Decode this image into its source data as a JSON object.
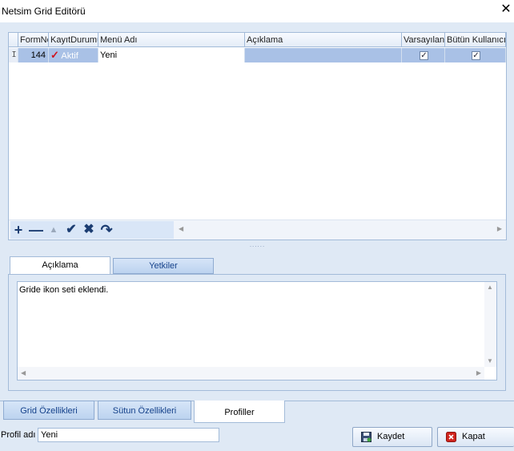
{
  "window": {
    "title": "Netsim Grid Editörü",
    "close_glyph": "✕"
  },
  "grid": {
    "columns": [
      "FormNo",
      "KayıtDurumu",
      "Menü Adı",
      "Açıklama",
      "Varsayılan",
      "Bütün Kullanıcılar"
    ],
    "rows": [
      {
        "indicator": "I",
        "form_no": "144",
        "kayit_durumu": "Aktif",
        "menu_adi": "Yeni",
        "aciklama": "",
        "varsayilan": "✓",
        "butun_kullanicilar": "✓"
      }
    ],
    "nav_icons": [
      "plus-icon",
      "minus-icon",
      "up-arrow-icon",
      "check-icon",
      "x-icon",
      "redo-icon"
    ],
    "nav_glyphs": {
      "add": "+",
      "remove": "—",
      "up": "▲",
      "check": "✔",
      "cancel": "✖",
      "refresh": "↷"
    },
    "scroll_left": "◀",
    "scroll_right": "▶"
  },
  "splitter_glyph": "......",
  "detail_tabs": {
    "aciklama": "Açıklama",
    "yetkiler": "Yetkiler"
  },
  "memo": {
    "text": "Gride ikon seti eklendi."
  },
  "bottom_tabs": {
    "grid": "Grid Özellikleri",
    "sutun": "Sütun Özellikleri",
    "profiller": "Profiller"
  },
  "profil": {
    "label": "Profil adı",
    "value": "Yeni"
  },
  "buttons": {
    "kaydet": "Kaydet",
    "kapat": "Kapat"
  },
  "colors": {
    "accent": "#15428b",
    "selection": "#a9c1e6",
    "border": "#a3bbd9",
    "check_red": "#d0141e"
  }
}
